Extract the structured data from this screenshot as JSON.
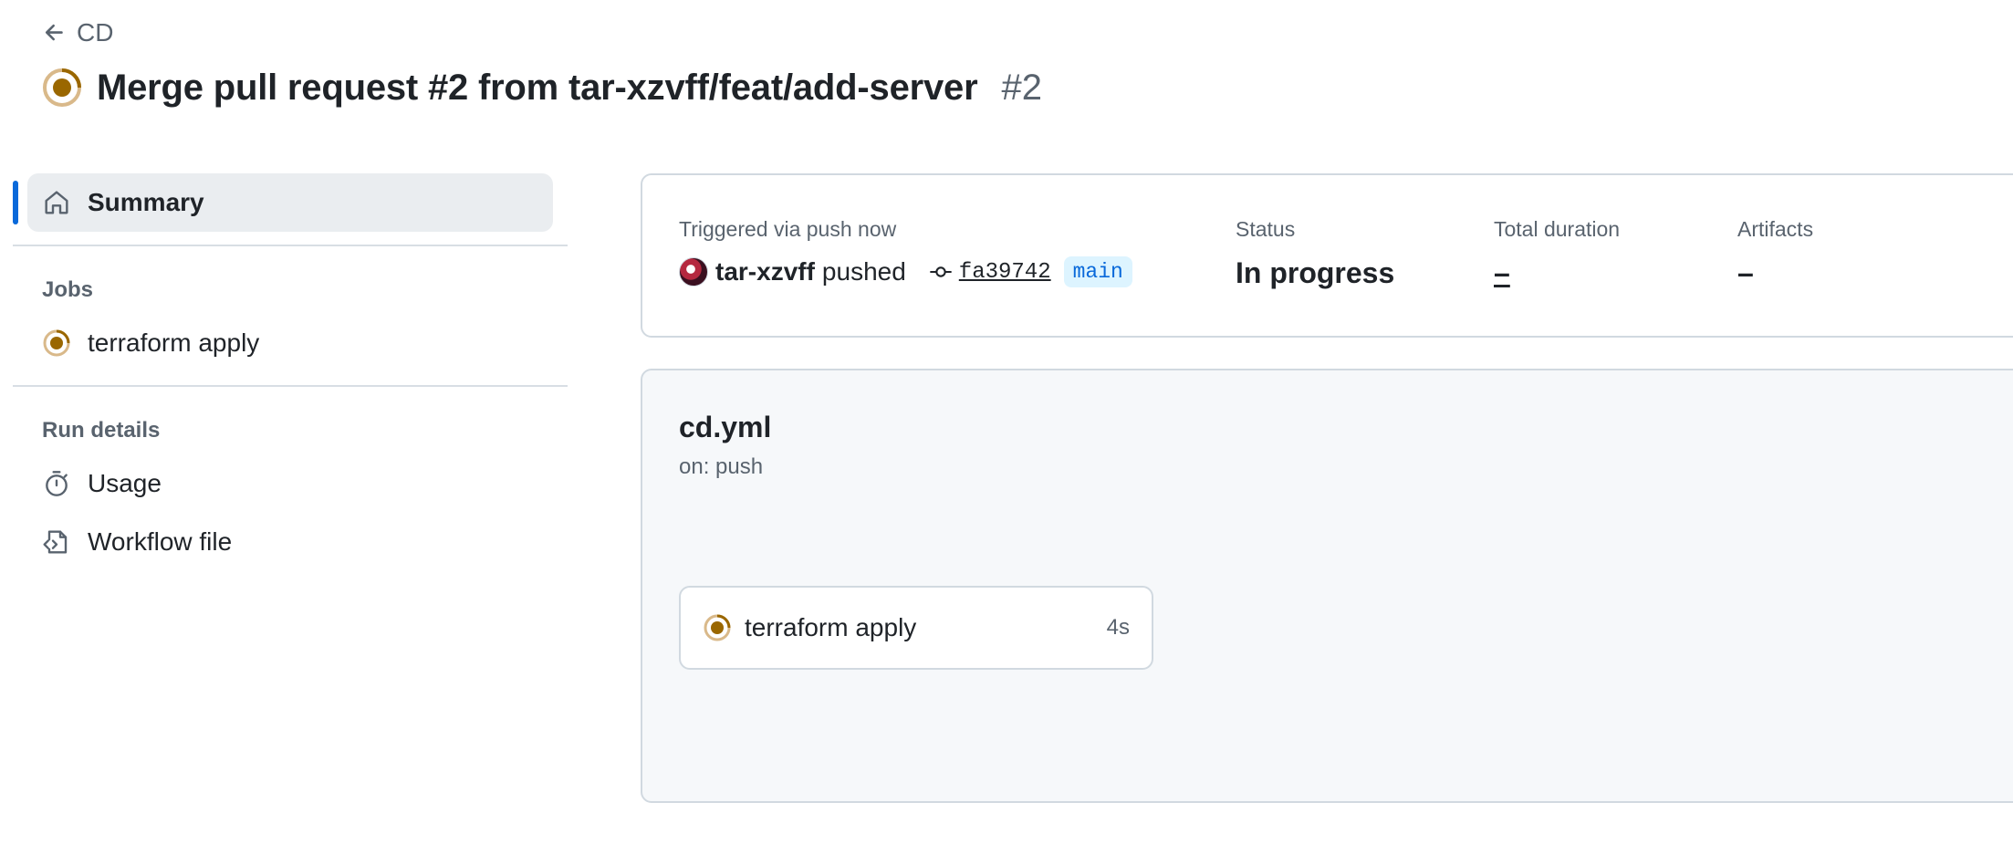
{
  "back_link": {
    "label": "CD"
  },
  "title": {
    "text": "Merge pull request #2 from tar-xzvff/feat/add-server",
    "run_number": "#2",
    "status_color": "#9a6700"
  },
  "sidebar": {
    "summary_label": "Summary",
    "jobs_heading": "Jobs",
    "jobs": [
      {
        "label": "terraform apply",
        "status": "in-progress"
      }
    ],
    "run_details_heading": "Run details",
    "run_details": [
      {
        "label": "Usage",
        "icon": "stopwatch-icon"
      },
      {
        "label": "Workflow file",
        "icon": "file-code-icon"
      }
    ]
  },
  "summary": {
    "trigger_label": "Triggered via push now",
    "actor": "tar-xzvff",
    "pushed_text": "pushed",
    "commit_sha": "fa39742",
    "branch": "main",
    "status_label": "Status",
    "status_value": "In progress",
    "duration_label": "Total duration",
    "duration_value": "–",
    "artifacts_label": "Artifacts",
    "artifacts_value": "–"
  },
  "workflow": {
    "file": "cd.yml",
    "trigger": "on: push",
    "jobs": [
      {
        "name": "terraform apply",
        "duration": "4s"
      }
    ]
  },
  "colors": {
    "accent": "#0969da",
    "in_progress": "#9a6700",
    "muted": "#59636e"
  }
}
